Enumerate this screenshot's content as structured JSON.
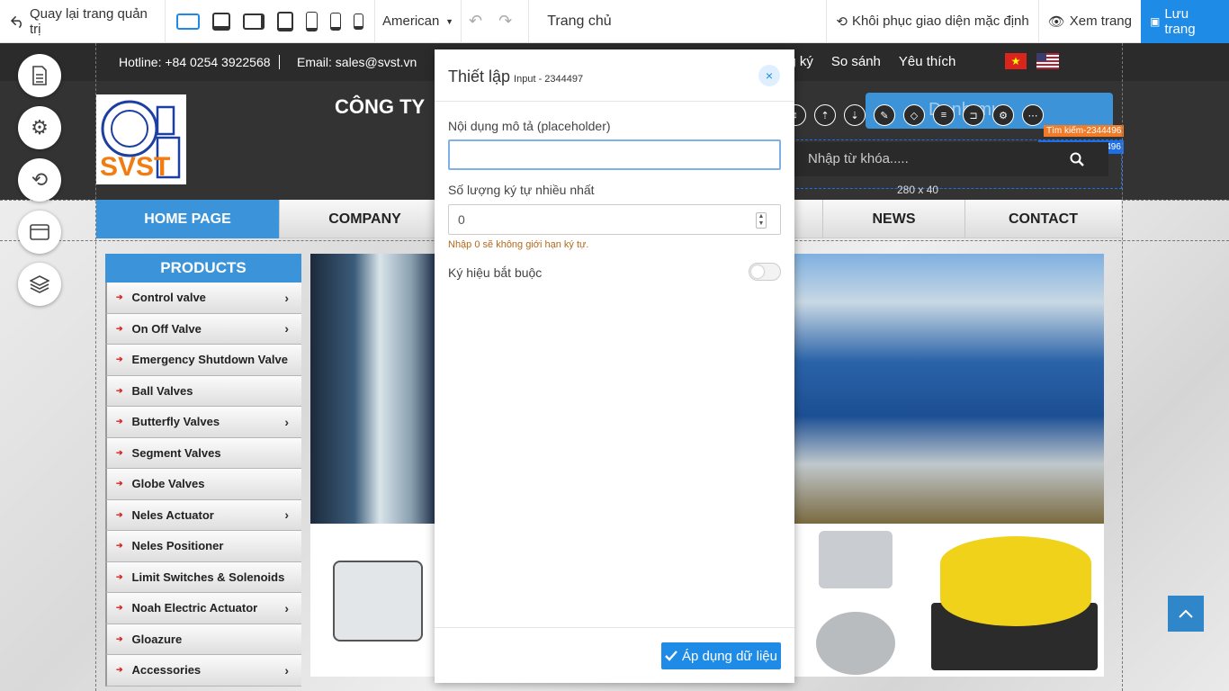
{
  "toolbar": {
    "back_label": "Quay lại trang quản trị",
    "language": "American",
    "page_name": "Trang chủ",
    "restore_label": "Khôi phục giao diện mặc định",
    "preview_label": "Xem trang",
    "save_label": "Lưu trang",
    "accent": "#1e8be6"
  },
  "site": {
    "hotline_label": "Hotline:",
    "hotline": "+84 0254 3922568",
    "email_label": "Email:",
    "email": "sales@svst.vn",
    "top_links": [
      "ng ký",
      "So sánh",
      "Yêu thích"
    ],
    "logo_text": "SVST",
    "company_partial": "CÔNG TY",
    "blue_block_text": "Danh mục",
    "search_placeholder": "Nhập từ khóa.....",
    "dimension_label": "280 x 40",
    "tag_orange": "Tìm kiếm-2344496",
    "tag_blue": "Tìm kiếm - 2344496",
    "nav": [
      {
        "label": "HOME PAGE",
        "active": true
      },
      {
        "label": "COMPANY",
        "active": false
      },
      {
        "label": "",
        "active": false
      },
      {
        "label": "NEWS",
        "active": false
      },
      {
        "label": "CONTACT",
        "active": false
      }
    ],
    "sidebar_title": "PRODUCTS",
    "sidebar": [
      {
        "label": "Control valve",
        "has_children": true
      },
      {
        "label": "On Off Valve",
        "has_children": true
      },
      {
        "label": "Emergency Shutdown Valve",
        "has_children": false
      },
      {
        "label": "Ball Valves",
        "has_children": false
      },
      {
        "label": "Butterfly Valves",
        "has_children": true
      },
      {
        "label": "Segment Valves",
        "has_children": false
      },
      {
        "label": "Globe Valves",
        "has_children": false
      },
      {
        "label": "Neles Actuator",
        "has_children": true
      },
      {
        "label": "Neles Positioner",
        "has_children": false
      },
      {
        "label": "Limit Switches & Solenoids",
        "has_children": false
      },
      {
        "label": "Noah Electric Actuator",
        "has_children": true
      },
      {
        "label": "Gloazure",
        "has_children": false
      },
      {
        "label": "Accessories",
        "has_children": true
      }
    ],
    "brand_blue": "#3b94d9"
  },
  "modal": {
    "title": "Thiết lập",
    "subtitle": "Input - 2344497",
    "placeholder_label": "Nội dụng mô tả (placeholder)",
    "placeholder_value": "",
    "max_chars_label": "Số lượng ký tự nhiều nhất",
    "max_chars_value": "0",
    "max_chars_hint": "Nhập 0 sẽ không giới hạn ký tự.",
    "required_label": "Ký hiệu bắt buộc",
    "required_on": false,
    "apply_label": "Áp dụng dữ liệu"
  }
}
